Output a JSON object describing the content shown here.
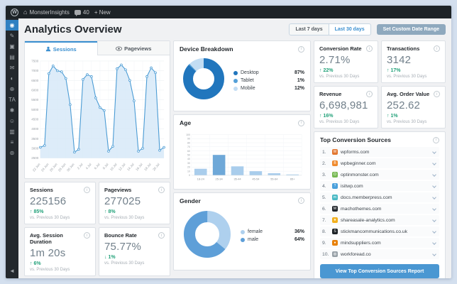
{
  "colors": {
    "accent": "#3a8fd0",
    "positive_green": "#21a179",
    "line_blue": "#4a9bd4",
    "line_fill": "#d7e9f8",
    "button_blue": "#4a97d2",
    "custom_range_btn": "#8fa9be",
    "admin_bar_bg": "#1d2327",
    "sidebar_bg": "#23282d",
    "sidebar_active": "#2f80c2"
  },
  "icons": {
    "info": "i",
    "up_arrow": "↑",
    "down_arrow": "↓",
    "wp_logo": "W",
    "home": "⌂"
  },
  "admin_bar": {
    "site_name": "MonsterInsights",
    "comment_count": "40",
    "new_label": "+ New"
  },
  "sidebar": {
    "items": [
      {
        "name": "monsterinsights",
        "glyph": "◉",
        "active": true
      },
      {
        "name": "posts",
        "glyph": "✎"
      },
      {
        "name": "media",
        "glyph": "▣"
      },
      {
        "name": "pages",
        "glyph": "▤"
      },
      {
        "name": "comments",
        "glyph": "✉"
      },
      {
        "name": "appearance",
        "glyph": "◐"
      },
      {
        "name": "plugins",
        "glyph": "⊕"
      },
      {
        "name": "ta-plugin",
        "glyph": "TA"
      },
      {
        "name": "tools",
        "glyph": "✱"
      },
      {
        "name": "users",
        "glyph": "☺"
      },
      {
        "name": "analytics",
        "glyph": "▥"
      },
      {
        "name": "menu",
        "glyph": "≡"
      },
      {
        "name": "settings",
        "glyph": "⊛"
      },
      {
        "name": "collapse",
        "glyph": "◄",
        "bottom": true
      }
    ]
  },
  "header": {
    "title": "Analytics Overview",
    "range_7": "Last 7 days",
    "range_30": "Last 30 days",
    "custom_range": "Set Custom Date Range"
  },
  "tabs": [
    {
      "label": "Sessions",
      "active": true
    },
    {
      "label": "Pageviews",
      "active": false
    }
  ],
  "chart_data": [
    {
      "type": "line",
      "title": "Sessions",
      "x": [
        "22 Jun",
        "23 Jun",
        "24 Jun",
        "25 Jun",
        "26 Jun",
        "27 Jun",
        "28 Jun",
        "29 Jun",
        "30 Jun",
        "1 Jul",
        "2 Jul",
        "3 Jul",
        "4 Jul",
        "5 Jul",
        "6 Jul",
        "7 Jul",
        "8 Jul",
        "9 Jul",
        "10 Jul",
        "11 Jul",
        "12 Jul",
        "13 Jul",
        "14 Jul",
        "15 Jul",
        "16 Jul",
        "17 Jul",
        "18 Jul",
        "19 Jul",
        "20 Jul",
        "21 Jul"
      ],
      "values": [
        3050,
        3150,
        6850,
        7250,
        7000,
        6950,
        6600,
        5250,
        2800,
        2950,
        6550,
        6800,
        6700,
        5600,
        5100,
        4950,
        2850,
        3100,
        7100,
        7300,
        7050,
        6500,
        5450,
        2850,
        3000,
        6700,
        7150,
        6900,
        2900,
        3050
      ],
      "ylim": [
        2500,
        7500
      ],
      "ytick_step": 500,
      "xtick_every": 2,
      "grid": true,
      "line_color": "#4a9bd4",
      "fill_color": "#d7e9f8"
    },
    {
      "type": "pie",
      "title": "Device Breakdown",
      "labels": [
        "Desktop",
        "Tablet",
        "Mobile"
      ],
      "values": [
        87,
        1,
        12
      ],
      "value_labels": [
        "87%",
        "1%",
        "12%"
      ],
      "colors": [
        "#2176bd",
        "#54a0d8",
        "#c2ddf3"
      ],
      "legend_position": "right"
    },
    {
      "type": "bar",
      "title": "Age",
      "categories": [
        "18-24",
        "25-34",
        "35-44",
        "45-54",
        "55-64",
        "65+"
      ],
      "values": [
        16,
        50,
        22,
        10,
        5,
        2
      ],
      "ylim": [
        0,
        100
      ],
      "ytick_step": 10,
      "bar_color": "#a9cdec",
      "highlight_index": 1,
      "highlight_color": "#6ea8d8",
      "grid": true
    },
    {
      "type": "pie",
      "title": "Gender",
      "labels": [
        "female",
        "male"
      ],
      "values": [
        36,
        64
      ],
      "value_labels": [
        "36%",
        "64%"
      ],
      "colors": [
        "#aed0ee",
        "#5e9fd8"
      ],
      "legend_position": "right"
    }
  ],
  "stats_left": [
    {
      "label": "Sessions",
      "value": "225156",
      "dir": "up",
      "change": "85%",
      "period": "vs. Previous 30 Days"
    },
    {
      "label": "Pageviews",
      "value": "277025",
      "dir": "up",
      "change": "8%",
      "period": "vs. Previous 30 Days"
    },
    {
      "label": "Avg. Session Duration",
      "value": "1m 20s",
      "dir": "up",
      "change": "6%",
      "period": "vs. Previous 30 Days"
    },
    {
      "label": "Bounce Rate",
      "value": "75.77%",
      "dir": "down",
      "change": "1%",
      "period": "vs. Previous 30 Days"
    }
  ],
  "stats_right": [
    {
      "label": "Conversion Rate",
      "value": "2.71%",
      "dir": "up",
      "change": "22%",
      "period": "vs. Previous 30 Days"
    },
    {
      "label": "Transactions",
      "value": "3142",
      "dir": "up",
      "change": "17%",
      "period": "vs. Previous 30 Days"
    },
    {
      "label": "Revenue",
      "value": "6,698,981",
      "dir": "up",
      "change": "16%",
      "period": "vs. Previous 30 Days"
    },
    {
      "label": "Avg. Order Value",
      "value": "252.62",
      "dir": "up",
      "change": "1%",
      "period": "vs. Previous 30 Days"
    }
  ],
  "sources": {
    "title": "Top Conversion Sources",
    "button": "View Top Conversion Sources Report",
    "items": [
      {
        "rank": "1.",
        "domain": "wpforms.com",
        "color": "#e27730",
        "glyph": "W"
      },
      {
        "rank": "2.",
        "domain": "wpbeginner.com",
        "color": "#ef8a2d",
        "glyph": "B"
      },
      {
        "rank": "3.",
        "domain": "optinmonster.com",
        "color": "#76b852",
        "glyph": "O"
      },
      {
        "rank": "4.",
        "domain": "isitwp.com",
        "color": "#4aa0dc",
        "glyph": "?"
      },
      {
        "rank": "5.",
        "domain": "docs.memberpress.com",
        "color": "#49b9c4",
        "glyph": "m"
      },
      {
        "rank": "6.",
        "domain": "machothemes.com",
        "color": "#23282d",
        "glyph": "M"
      },
      {
        "rank": "7.",
        "domain": "shareasale-analytics.com",
        "color": "#f2b01e",
        "glyph": "★"
      },
      {
        "rank": "8.",
        "domain": "stickmancommunications.co.uk",
        "color": "#1d2327",
        "glyph": "S"
      },
      {
        "rank": "9.",
        "domain": "mindsuppliers.com",
        "color": "#e8820c",
        "glyph": "●"
      },
      {
        "rank": "10.",
        "domain": "workforead.co",
        "color": "#98a1a8",
        "glyph": "◍"
      }
    ]
  }
}
